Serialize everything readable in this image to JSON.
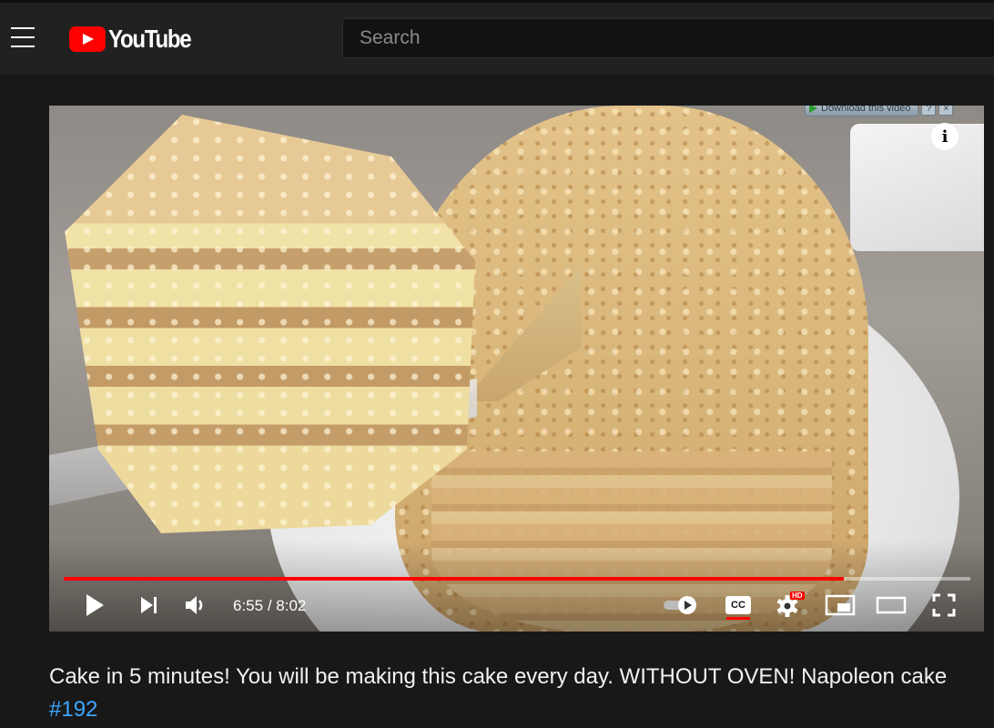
{
  "app": {
    "brand": "YouTube"
  },
  "search": {
    "placeholder": "Search"
  },
  "player": {
    "download_label": "Download this video",
    "download_help": "?",
    "download_close": "×",
    "info_label": "i",
    "current_time": "6:55",
    "separator": " / ",
    "duration": "8:02",
    "progress_fraction": 0.8607,
    "icons": {
      "play": "play-icon",
      "next": "next-icon",
      "volume": "volume-icon",
      "autoplay": "autoplay-toggle-icon",
      "captions": "captions-icon",
      "settings": "gear-icon",
      "miniplayer": "miniplayer-icon",
      "theater": "theater-mode-icon",
      "fullscreen": "fullscreen-icon"
    },
    "cc_label": "CC",
    "hd_badge": "HD",
    "colors": {
      "progress": "#ff0000",
      "accent_link": "#3ea6ff"
    }
  },
  "video": {
    "title": "Cake in 5 minutes! You will be making this cake every day. WITHOUT OVEN! Napoleon cake",
    "hashtag": "#192"
  }
}
